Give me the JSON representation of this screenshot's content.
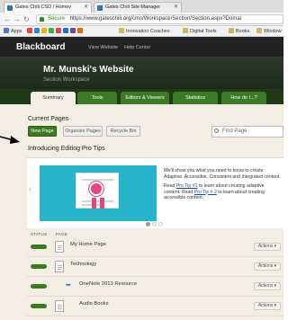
{
  "browser": {
    "tabs": [
      {
        "label": "Gates Chili CSD / Homev",
        "active": true
      },
      {
        "label": "Gates Chili Site Manager",
        "active": false
      }
    ],
    "secure_label": "Secure",
    "url": "https://www.gateschili.org/cms/Workspace/Section/Section.aspx?Domai",
    "bookmarks": [
      {
        "label": "Apps"
      },
      {
        "label": "Innovation Coaches"
      },
      {
        "label": "Digital Tools"
      },
      {
        "label": "Books"
      },
      {
        "label": "Window"
      }
    ]
  },
  "topbar": {
    "logo": "Blackboard",
    "links": [
      "View Website",
      "Help Center"
    ]
  },
  "course": {
    "title": "Mr. Munski's Website",
    "subtitle": "Section Workspace"
  },
  "course_nav": {
    "tabs": [
      "Summary",
      "Tools",
      "Editors & Viewers",
      "Statistics",
      "How do I...?"
    ],
    "active": "Summary"
  },
  "current_pages": {
    "title": "Current Pages",
    "buttons": {
      "new_page": "New Page",
      "organize": "Organize Pages",
      "recycle": "Recycle Bin"
    },
    "search_placeholder": "Find Page"
  },
  "tips": {
    "title": "Introducing Editing Pro Tips",
    "p1": "We'll show you what you need to know to create Adaptive, Accessible, Consistent and Integrated content.",
    "p2_prefix": "Read ",
    "p2_link": "Pro Tip #1",
    "p2_suffix": " to learn about creating adaptive content. Read ",
    "p3_link": "Pro Tip # 2",
    "p3_suffix": " to learn about creating accessible content.",
    "slides": 3,
    "active_slide": 1
  },
  "table": {
    "col_status": "STATUS",
    "col_page": "PAGE",
    "rows": [
      {
        "title": "My Home Page",
        "status": "published",
        "child": false,
        "actions": "Actions ▾"
      },
      {
        "title": "Technology",
        "status": "published",
        "child": false,
        "actions": "Actions ▾"
      },
      {
        "title": "OneNote 2013 Resource",
        "status": "published",
        "child": true,
        "actions": "Actions ▾"
      },
      {
        "title": "Audio Books",
        "status": "published",
        "child": false,
        "actions": "Actions ▾"
      }
    ]
  },
  "colors": {
    "accent_green": "#3b7a23",
    "nav_dark": "#1f3a14",
    "content_bg": "#f3eee3",
    "tips_image_bg": "#27b3c9",
    "ribbon": "#e5457a"
  }
}
